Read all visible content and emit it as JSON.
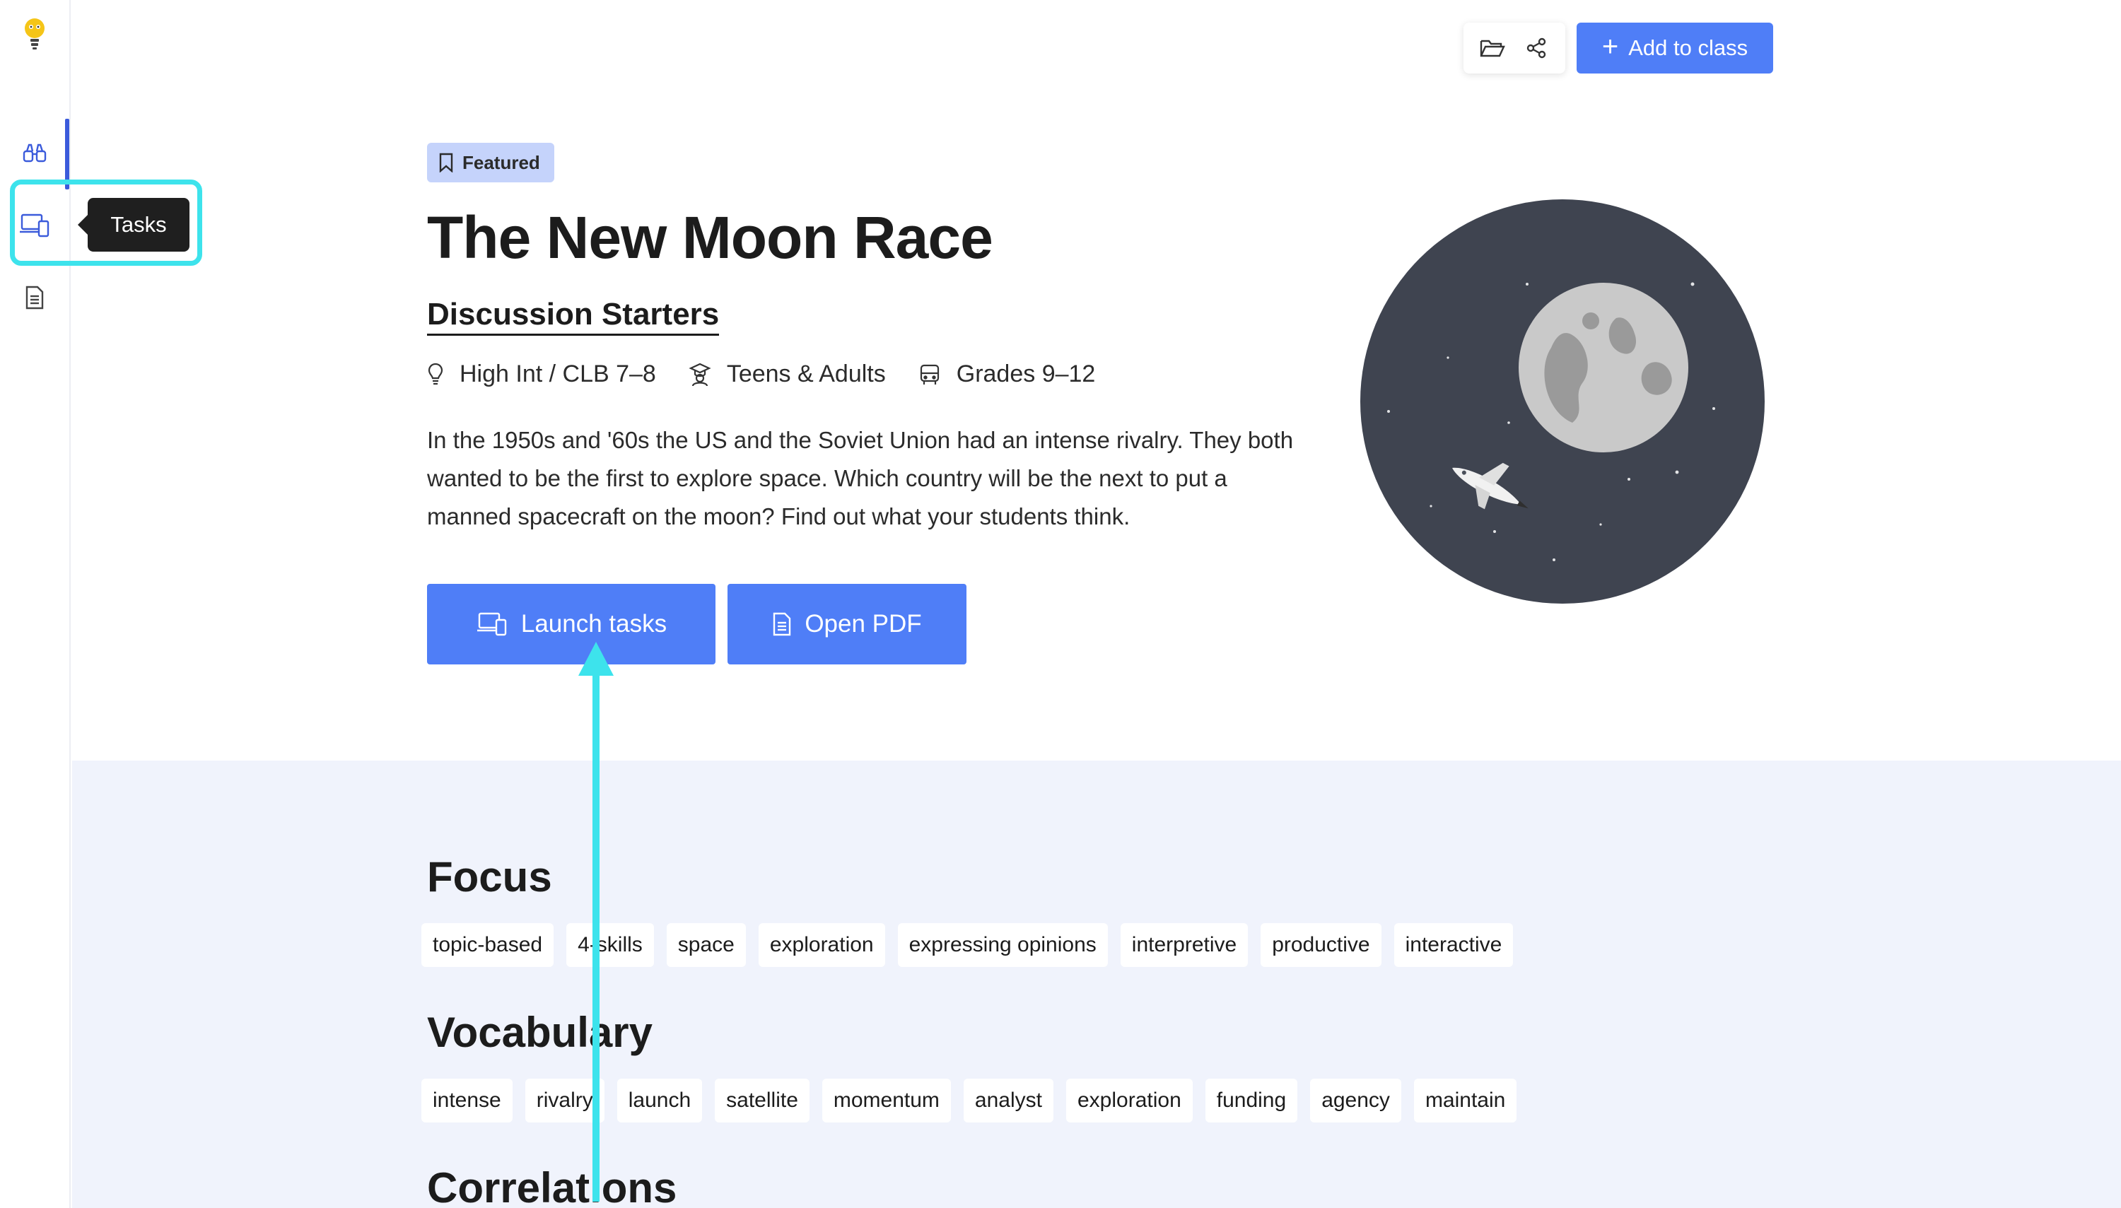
{
  "sidebar": {
    "tooltip": "Tasks",
    "items": [
      {
        "name": "explore",
        "icon": "binoculars-icon"
      },
      {
        "name": "tasks",
        "icon": "devices-icon"
      },
      {
        "name": "documents",
        "icon": "document-icon"
      }
    ]
  },
  "toolbar": {
    "folder_icon": "folder-icon",
    "share_icon": "share-icon",
    "add_to_class_label": "Add to class"
  },
  "lesson": {
    "badge": "Featured",
    "title": "The New Moon Race",
    "subtitle": "Discussion Starters",
    "level": "High Int / CLB 7–8",
    "audience": "Teens & Adults",
    "grades": "Grades 9–12",
    "description": "In the 1950s and '60s the US and the Soviet Union had an intense rivalry. They both wanted to be the first to explore space. Which country will be the next to put a manned spacecraft on the moon? Find out what your students think.",
    "launch_label": "Launch tasks",
    "pdf_label": "Open PDF"
  },
  "focus": {
    "title": "Focus",
    "tags": [
      "topic-based",
      "4-skills",
      "space",
      "exploration",
      "expressing opinions",
      "interpretive",
      "productive",
      "interactive"
    ]
  },
  "vocabulary": {
    "title": "Vocabulary",
    "tags": [
      "intense",
      "rivalry",
      "launch",
      "satellite",
      "momentum",
      "analyst",
      "exploration",
      "funding",
      "agency",
      "maintain"
    ]
  },
  "correlations": {
    "title": "Correlations"
  },
  "colors": {
    "accent": "#4f7ef7",
    "annotation": "#3de3ec",
    "lower_bg": "#f0f3fc",
    "moon_bg": "#3f4450"
  }
}
